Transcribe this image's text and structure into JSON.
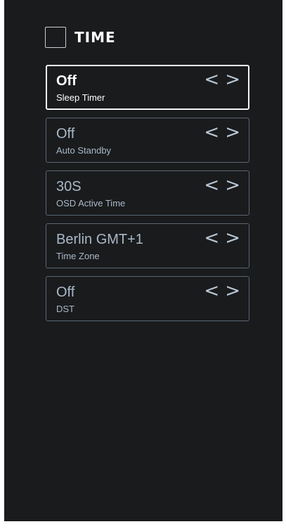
{
  "header": {
    "title": "TIME"
  },
  "items": [
    {
      "value": "Off",
      "label": "Sleep Timer",
      "selected": true,
      "prev": "<",
      "next": ">"
    },
    {
      "value": "Off",
      "label": "Auto Standby",
      "selected": false,
      "prev": "<",
      "next": ">"
    },
    {
      "value": "30S",
      "label": "OSD Active Time",
      "selected": false,
      "prev": "<",
      "next": ">"
    },
    {
      "value": "Berlin GMT+1",
      "label": "Time Zone",
      "selected": false,
      "prev": "<",
      "next": ">"
    },
    {
      "value": "Off",
      "label": "DST",
      "selected": false,
      "prev": "<",
      "next": ">"
    }
  ],
  "colors": {
    "background": "#1a1b1d",
    "item_border": "#5a6674",
    "selected_border": "#f4f4f4",
    "text_inactive": "#a9b9c8",
    "text_active": "#ffffff"
  }
}
